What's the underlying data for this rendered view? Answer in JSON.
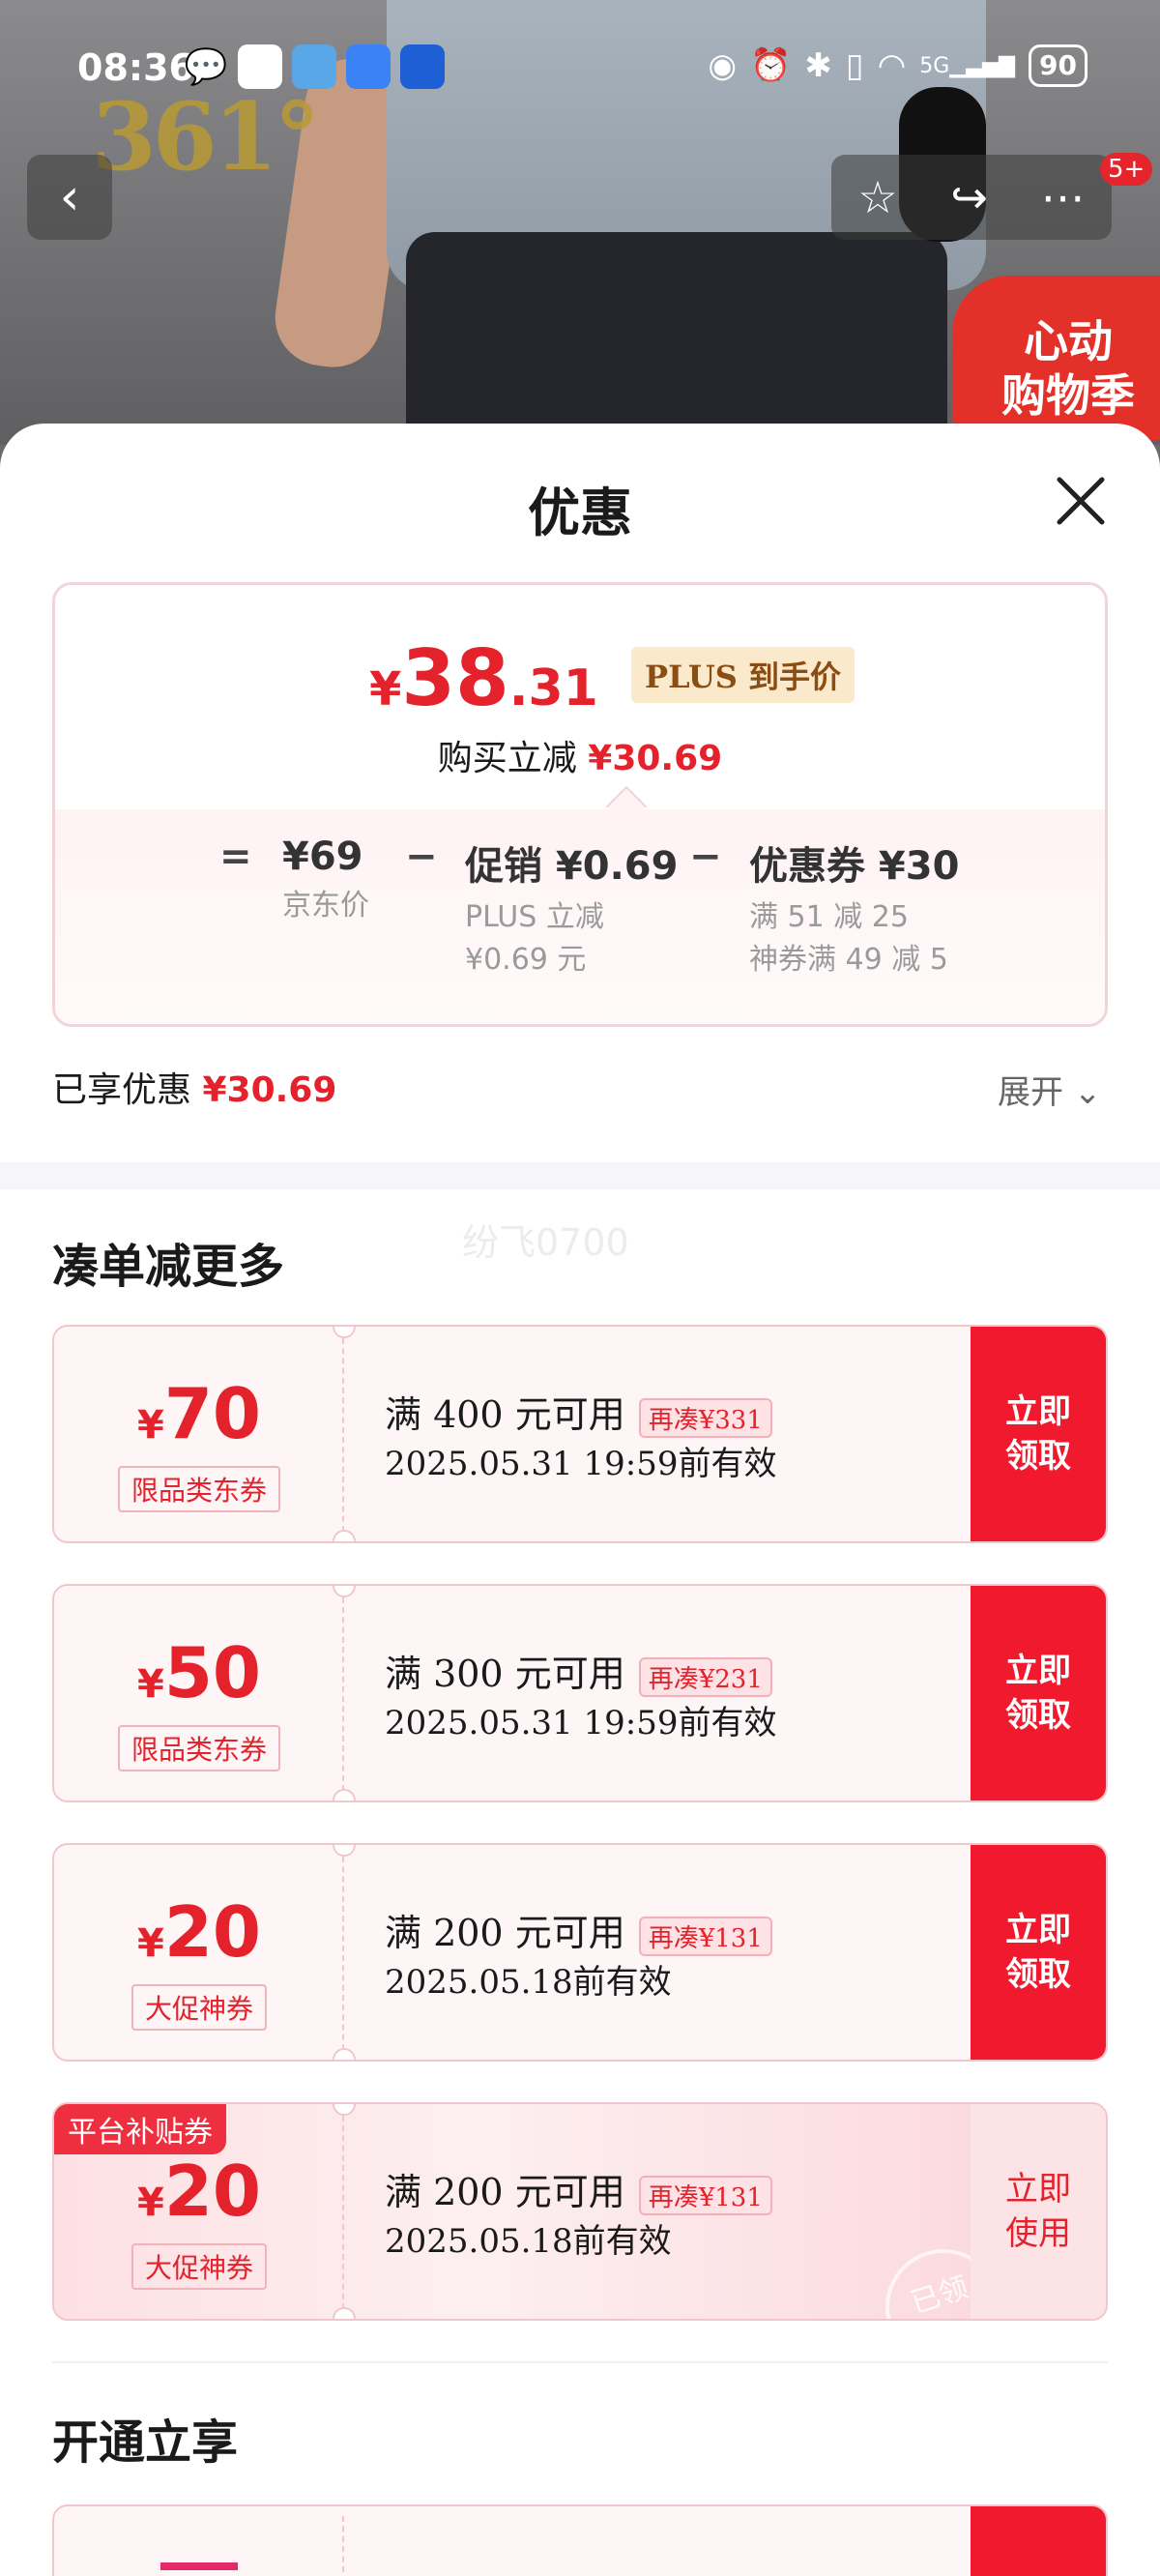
{
  "status_bar": {
    "time": "08:36",
    "battery": "90",
    "network": "5G"
  },
  "background": {
    "brand_text": "361°",
    "promo_badge_line1": "心动",
    "promo_badge_line2": "购物季",
    "cart_badge": "5+"
  },
  "sheet": {
    "title": "优惠",
    "summary": {
      "price_currency": "¥",
      "price_int": "38",
      "price_dec": ".31",
      "plus_tag": "PLUS 到手价",
      "reduce_label": "购买立减",
      "reduce_value": "¥30.69",
      "eq": "=",
      "minus": "−",
      "jd_price": "¥69",
      "jd_price_label": "京东价",
      "promo_value": "促销 ¥0.69",
      "promo_sub1": "PLUS 立减",
      "promo_sub2": "¥0.69 元",
      "coupon_value": "优惠券 ¥30",
      "coupon_sub1": "满 51 减 25",
      "coupon_sub2": "神券满 49 减 5"
    },
    "enjoyed_label": "已享优惠",
    "enjoyed_value": "¥30.69",
    "expand_label": "展开",
    "section_more": "凑单减更多",
    "watermark": "纷飞0700",
    "coupons": [
      {
        "amount": "70",
        "kind": "限品类东券",
        "condition": "满 400 元可用",
        "tag": "再凑¥331",
        "valid": "2025.05.31 19:59前有效",
        "button": "立即\n领取"
      },
      {
        "amount": "50",
        "kind": "限品类东券",
        "condition": "满 300 元可用",
        "tag": "再凑¥231",
        "valid": "2025.05.31 19:59前有效",
        "button": "立即\n领取"
      },
      {
        "amount": "20",
        "kind": "大促神券",
        "condition": "满 200 元可用",
        "tag": "再凑¥131",
        "valid": "2025.05.18前有效",
        "button": "立即\n领取"
      },
      {
        "amount": "20",
        "kind": "大促神券",
        "condition": "满 200 元可用",
        "tag": "再凑¥131",
        "valid": "2025.05.18前有效",
        "button": "立即\n使用",
        "sub_label": "平台补贴券",
        "stamp": "已领"
      }
    ],
    "section_open": "开通立享"
  },
  "colors": {
    "accent_red": "#e4222c",
    "button_red": "#f0192e",
    "plus_gold": "#8a4d13"
  },
  "icons": [
    "back-icon",
    "star-icon",
    "share-icon",
    "more-icon",
    "close-icon",
    "chevron-down-icon"
  ]
}
